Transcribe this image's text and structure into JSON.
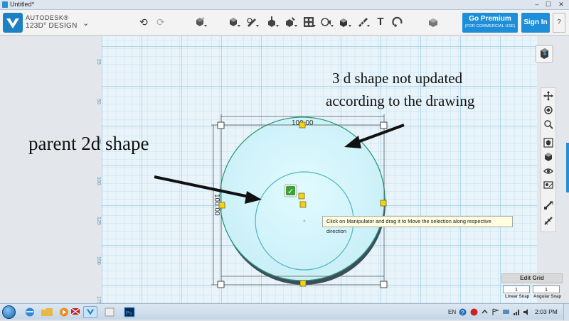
{
  "window": {
    "title": "Untitled*",
    "minimize_glyph": "–",
    "maximize_glyph": "☐",
    "close_glyph": "✕"
  },
  "app": {
    "brand_line1": "AUTODESK®",
    "brand_line2": "123D° DESIGN",
    "menu_icon": "chevron-down-icon",
    "menu_glyph": "⌄"
  },
  "toolbar": {
    "undo_icon": "undo-icon",
    "undo_glyph": "⟲",
    "redo_icon": "redo-icon",
    "redo_glyph": "⟳",
    "tools": [
      "transform-icon",
      "primitives-icon",
      "sketch-icon",
      "construct-icon",
      "modify-icon",
      "pattern-icon",
      "grouping-icon",
      "combine-icon",
      "measure-icon",
      "text-icon",
      "snap-icon",
      "material-icon"
    ],
    "text_glyph": "T",
    "premium_label": "Go Premium",
    "premium_sublabel": "(FOR COMMERCIAL USE)",
    "signin_label": "Sign In",
    "help_glyph": "?"
  },
  "ruler": {
    "labels": [
      "25",
      "50",
      "75",
      "100",
      "125",
      "150",
      "175"
    ]
  },
  "dimensions": {
    "width": "100.00",
    "height": "100.00"
  },
  "annotations": {
    "top_right_line1": "3 d shape not updated",
    "top_right_line2": "according to the drawing",
    "left": "parent 2d shape"
  },
  "tooltip": "Click on Manipulator and drag it to Move the selection along respective direction",
  "confirm_glyph": "✓",
  "nav": {
    "items": [
      "pan-icon",
      "orbit-icon",
      "zoom-icon",
      "fit-icon",
      "view-mode-icon",
      "visibility-icon",
      "material-view-icon",
      "snap-icon",
      "edit-grid-icon"
    ]
  },
  "edit_grid": {
    "title": "Edit Grid",
    "linear_value": "1",
    "angular_value": "1",
    "linear_label": "Linear Snap",
    "angular_label": "Angular Snap"
  },
  "taskbar": {
    "language": "EN",
    "time": "2:03 PM",
    "apps": [
      "ie-icon",
      "folder-icon",
      "media-player-icon",
      "chrome-icon",
      "network-icon",
      "123d-design-icon",
      "files-icon",
      "photoshop-icon"
    ]
  },
  "colors": {
    "accent": "#1f8ed8",
    "grid_minor": "#b6dbec",
    "grid_major": "#8ec3dd",
    "shape_fill": "#d6f5fb",
    "shape_edge": "#2a9a7a",
    "handle": "#f5d21a"
  }
}
